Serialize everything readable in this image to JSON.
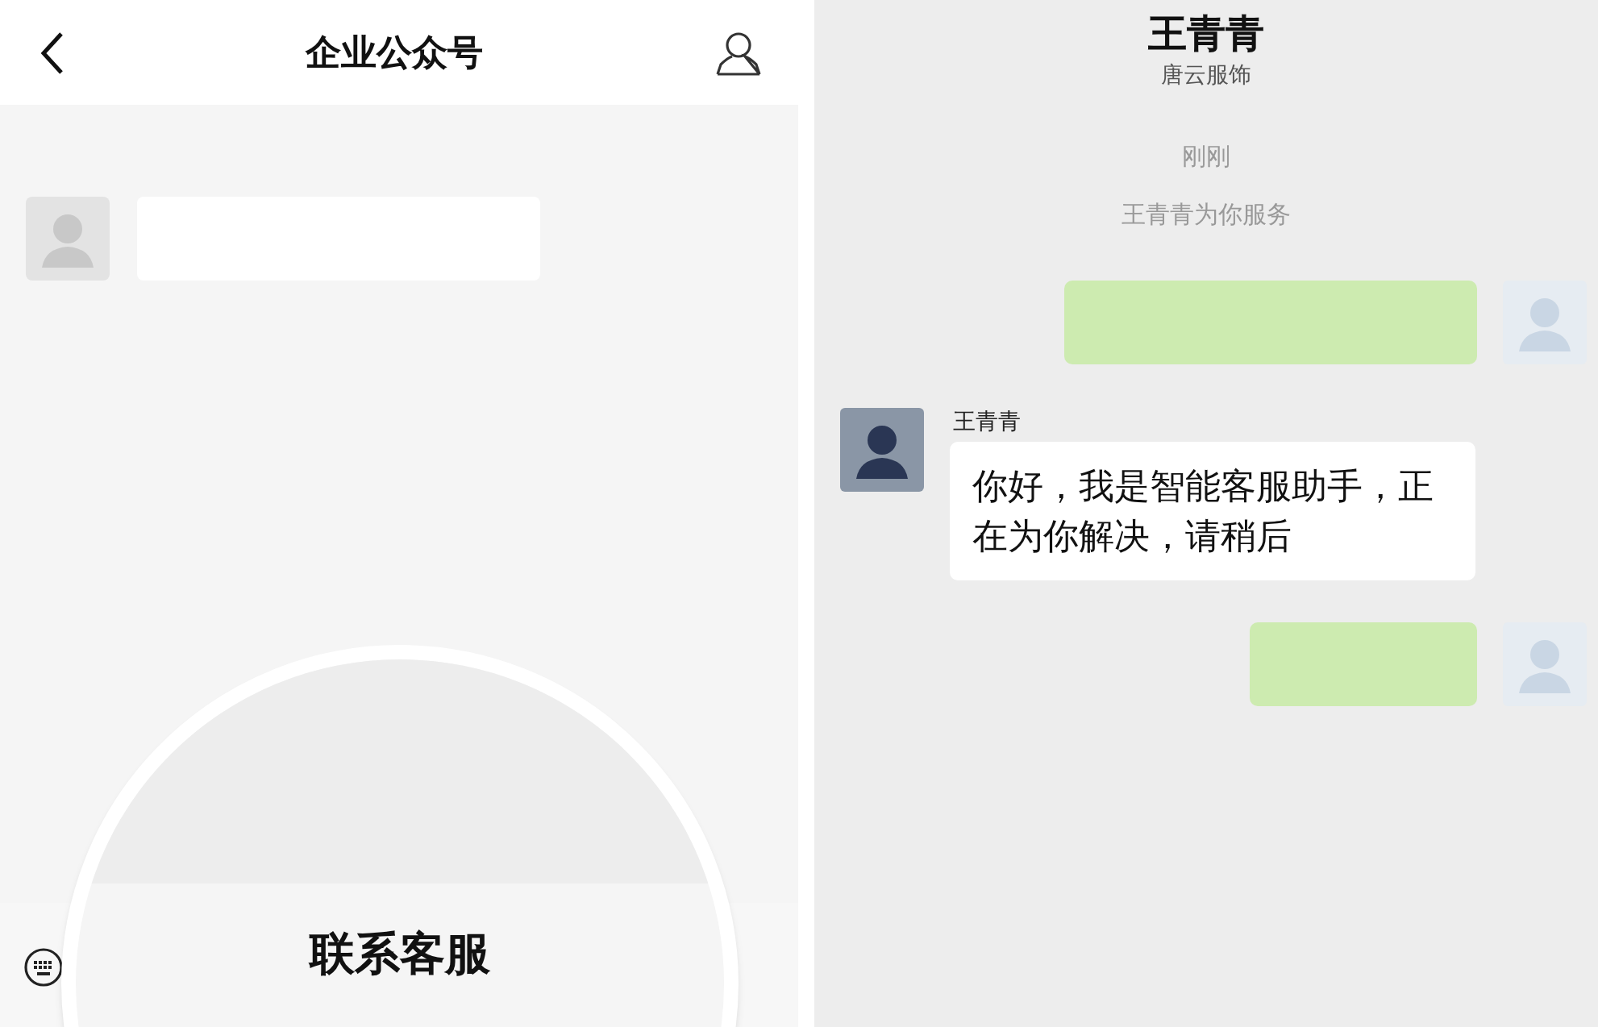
{
  "left_screen": {
    "title": "企业公众号",
    "messages": [
      {
        "kind": "incoming"
      }
    ],
    "magnifier_label": "联系客服"
  },
  "right_screen": {
    "title": "王青青",
    "subtitle": "唐云服饰",
    "time": "刚刚",
    "system_notice": "王青青为你服务",
    "messages": [
      {
        "kind": "outgoing"
      },
      {
        "kind": "incoming",
        "sender": "王青青",
        "text": "你好，我是智能客服助手，正在为你解决，请稍后"
      },
      {
        "kind": "outgoing"
      }
    ]
  }
}
